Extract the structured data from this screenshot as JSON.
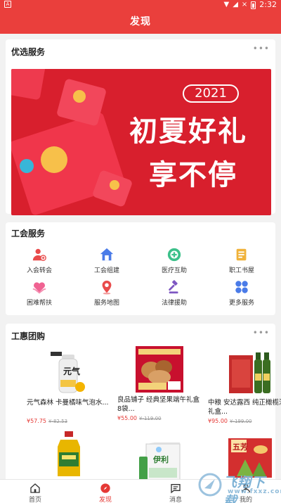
{
  "status_bar": {
    "left_badge": "A",
    "time": "2:32",
    "badge": "×"
  },
  "header": {
    "title": "发现"
  },
  "featured": {
    "title": "优选服务",
    "more": "•••",
    "banner": {
      "year": "2021",
      "line1": "初夏好礼",
      "line2": "享不停"
    }
  },
  "union": {
    "title": "工会服务",
    "items": [
      {
        "label": "入会转会",
        "icon": "user-plus-icon",
        "color": "#e94b4b"
      },
      {
        "label": "工会组建",
        "icon": "home-icon",
        "color": "#4a7be8"
      },
      {
        "label": "医疗互助",
        "icon": "medical-icon",
        "color": "#3cc08a"
      },
      {
        "label": "职工书屋",
        "icon": "book-icon",
        "color": "#f0b23a"
      },
      {
        "label": "困难帮扶",
        "icon": "heart-hands-icon",
        "color": "#f06292"
      },
      {
        "label": "服务地图",
        "icon": "map-pin-icon",
        "color": "#e94b4b"
      },
      {
        "label": "法律援助",
        "icon": "gavel-icon",
        "color": "#7e57c2"
      },
      {
        "label": "更多服务",
        "icon": "more-apps-icon",
        "color": "#4a7be8"
      }
    ]
  },
  "group_buy": {
    "title": "工惠团购",
    "more": "•••",
    "products": [
      {
        "name": "元气森林 卡曼橘味气泡水...",
        "price": "¥57.75",
        "old_price": "¥-82.53"
      },
      {
        "name": "良品铺子 经典坚果端午礼盒8袋...",
        "price": "¥55.00",
        "old_price": "¥-119.00"
      },
      {
        "name": "中粮 安达露西 纯正橄榄油礼盒...",
        "price": "¥95.00",
        "old_price": "¥-199.00"
      },
      {
        "name": "",
        "price": "",
        "old_price": ""
      },
      {
        "name": "",
        "price": "",
        "old_price": ""
      },
      {
        "name": "",
        "price": "",
        "old_price": ""
      }
    ],
    "labels": {
      "drink_brand": "元气",
      "gift_box": "伊利",
      "festival": "五芳"
    }
  },
  "bottom_nav": [
    {
      "label": "首页",
      "icon": "home-icon",
      "active": false
    },
    {
      "label": "发现",
      "icon": "compass-icon",
      "active": true
    },
    {
      "label": "消息",
      "icon": "message-icon",
      "active": false
    },
    {
      "label": "我的",
      "icon": "user-icon",
      "active": false
    }
  ],
  "watermark": {
    "text": "飞翔下载",
    "sub": "www.fxxz.com"
  }
}
